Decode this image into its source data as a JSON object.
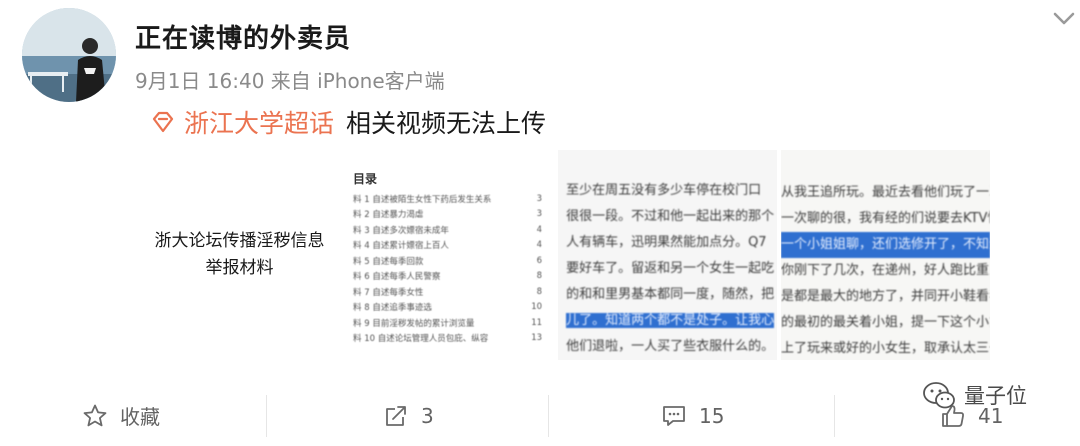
{
  "post": {
    "username": "正在读博的外卖员",
    "meta": "9月1日 16:40 来自 iPhone客户端",
    "topic_link": "浙江大学超话",
    "topic_text": "相关视频无法上传"
  },
  "images": {
    "cover_line1": "浙大论坛传播淫秽信息",
    "cover_line2": "举报材料",
    "toc_title": "目录",
    "toc": [
      {
        "label": "料 1  自述被陌生女性下药后发生关系",
        "page": "3"
      },
      {
        "label": "料 2  自述暴力渴虐",
        "page": "3"
      },
      {
        "label": "料 3  自述多次嫖宿未成年",
        "page": "4"
      },
      {
        "label": "料 4  自述累计嫖宿上百人",
        "page": "4"
      },
      {
        "label": "料 5  自述每季回款",
        "page": "6"
      },
      {
        "label": "料 6  自述每季人民警察",
        "page": "8"
      },
      {
        "label": "料 7  自述每季女性",
        "page": "8"
      },
      {
        "label": "料 8  自述追季事迹选",
        "page": "10"
      },
      {
        "label": "料 9  目前淫秽发帖的累计浏览量",
        "page": "11"
      },
      {
        "label": "料 10 自述论坛管理人员包庇、纵容",
        "page": "13"
      }
    ],
    "chat1_lines": [
      "至少在周五没有多少车停在校门口",
      "很很一段。不过和他一起出来的那个",
      "人有辆车，迅明果然能加点分。Q7",
      "要好车了。留返和另一个女生一起吃",
      "的和和里男基本都同一度，随然，把",
      "儿了。知道两个都不是处子。让我心",
      "他们退啦，一人买了些衣服什么的。"
    ],
    "chat2_lines": [
      "从我王追所玩。最近去看他们玩了一次",
      "一次聊的很，我有经的们说要去KTV快刻",
      "一个小姐姐聊，还们选修开了，不知道",
      "你刚下了几次，在递州，好人跑比重人员",
      "是都是最大的地方了，并同开小鞋看我",
      "的最初的最关着小姐，提一下这个小姐",
      "上了玩来或好的小女生，取承认太三一"
    ]
  },
  "actions": {
    "favorite_label": "收藏",
    "repost_count": "3",
    "comment_count": "15",
    "like_count": "41"
  },
  "watermark": "量子位",
  "colors": {
    "topic": "#eb7350",
    "highlight": "#2f6fd0"
  }
}
